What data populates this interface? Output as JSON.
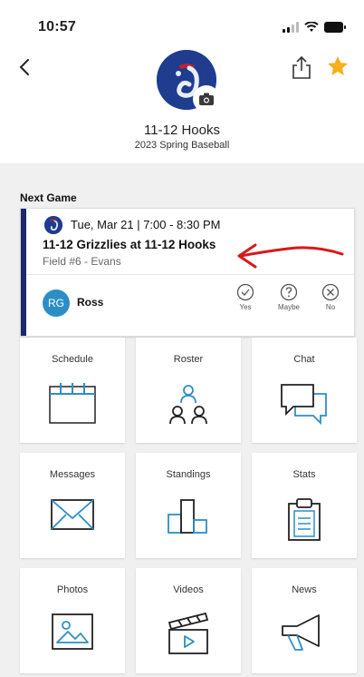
{
  "status": {
    "time": "10:57"
  },
  "header": {
    "team_name": "11-12 Hooks",
    "season": "2023 Spring Baseball"
  },
  "next_game": {
    "section_label": "Next Game",
    "date_time": "Tue, Mar 21 | 7:00 - 8:30 PM",
    "matchup": "11-12 Grizzlies at 11-12 Hooks",
    "location": "Field #6 - Evans",
    "player_initials": "RG",
    "player_name": "Ross",
    "rsvp": {
      "yes": "Yes",
      "maybe": "Maybe",
      "no": "No"
    }
  },
  "tiles": [
    {
      "label": "Schedule",
      "icon": "calendar-icon"
    },
    {
      "label": "Roster",
      "icon": "people-icon"
    },
    {
      "label": "Chat",
      "icon": "chat-bubbles-icon"
    },
    {
      "label": "Messages",
      "icon": "envelope-icon"
    },
    {
      "label": "Standings",
      "icon": "podium-icon"
    },
    {
      "label": "Stats",
      "icon": "clipboard-icon"
    },
    {
      "label": "Photos",
      "icon": "photo-icon"
    },
    {
      "label": "Videos",
      "icon": "clapperboard-icon"
    },
    {
      "label": "News",
      "icon": "megaphone-icon"
    }
  ],
  "colors": {
    "accent_star": "#f5b01a",
    "card_bar": "#1c2a6b",
    "icon_blue": "#2d8ec6",
    "annotation_red": "#d61a1a"
  }
}
